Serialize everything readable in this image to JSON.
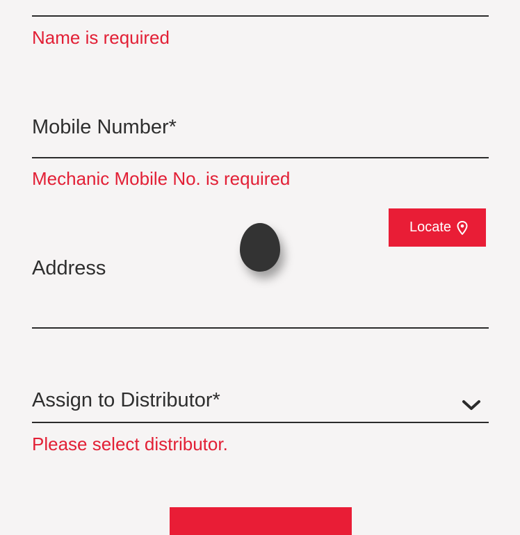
{
  "name_field": {
    "error": "Name is required"
  },
  "mobile_field": {
    "label": "Mobile Number*",
    "error": "Mechanic Mobile No. is required"
  },
  "locate_button": {
    "label": "Locate",
    "icon": "map-pin-icon"
  },
  "address_field": {
    "label": "Address"
  },
  "distributor_field": {
    "label": "Assign to Distributor*",
    "icon": "chevron-down-icon",
    "error": "Please select distributor."
  },
  "colors": {
    "accent": "#e91d36",
    "error": "#e21f35",
    "text": "#2e2e2e",
    "background": "#f6f4f4"
  }
}
